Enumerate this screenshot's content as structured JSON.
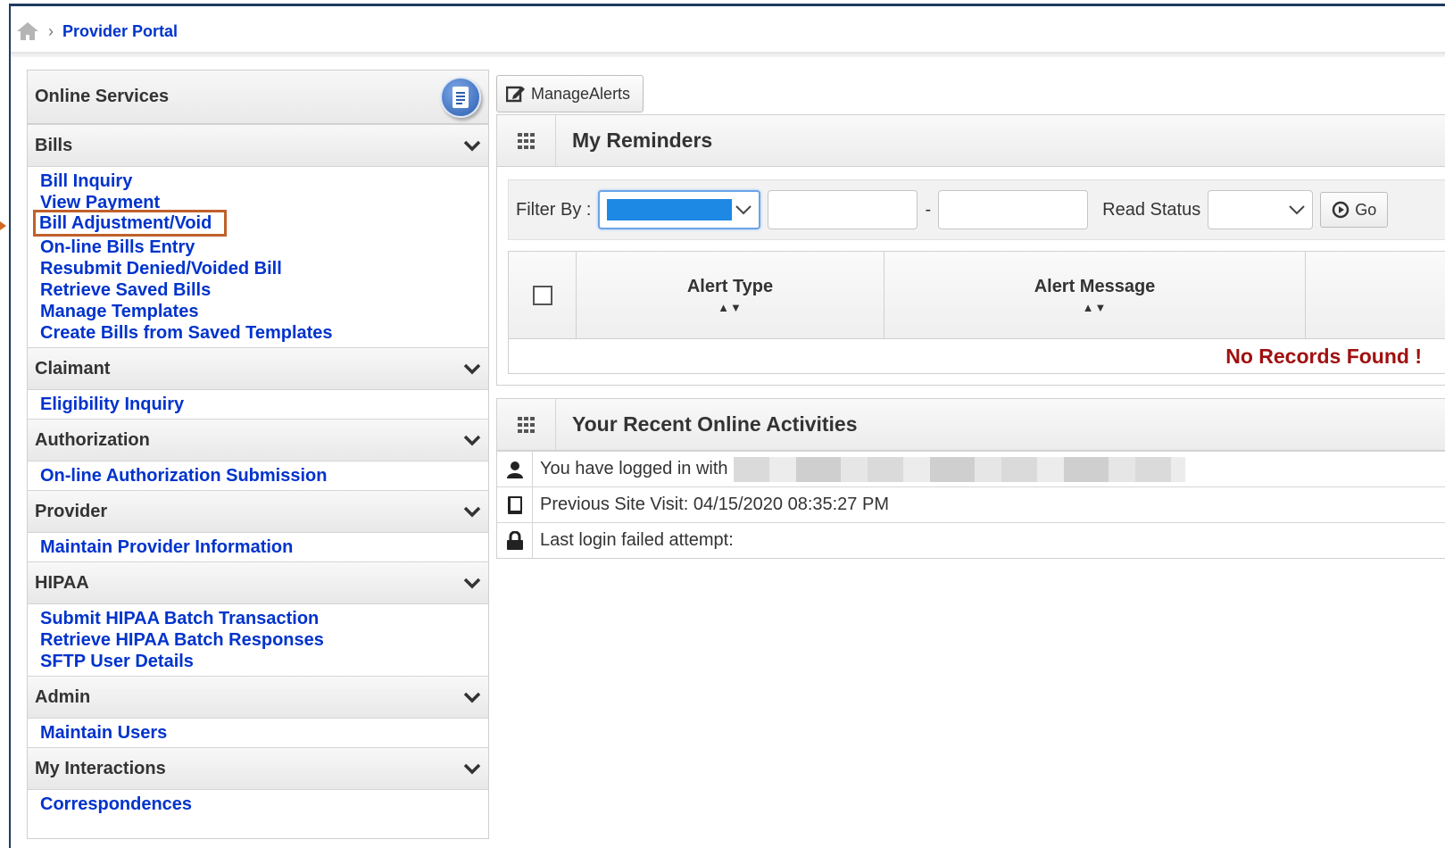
{
  "breadcrumb": {
    "home_icon": "home-icon",
    "separator": "›",
    "current": "Provider Portal"
  },
  "sidebar": {
    "title": "Online Services",
    "icon": "document-icon",
    "sections": [
      {
        "title": "Bills",
        "links": [
          "Bill Inquiry",
          "View Payment",
          "Bill Adjustment/Void",
          "On-line Bills Entry",
          "Resubmit Denied/Voided Bill",
          "Retrieve Saved Bills",
          "Manage Templates",
          "Create Bills from Saved Templates"
        ]
      },
      {
        "title": "Claimant",
        "links": [
          "Eligibility Inquiry"
        ]
      },
      {
        "title": "Authorization",
        "links": [
          "On-line Authorization Submission"
        ]
      },
      {
        "title": "Provider",
        "links": [
          "Maintain Provider Information"
        ]
      },
      {
        "title": "HIPAA",
        "links": [
          "Submit HIPAA Batch Transaction",
          "Retrieve HIPAA Batch Responses",
          "SFTP User Details"
        ]
      },
      {
        "title": "Admin",
        "links": [
          "Maintain Users"
        ]
      },
      {
        "title": "My Interactions",
        "links": [
          "Correspondences"
        ]
      }
    ]
  },
  "manage_alerts": {
    "label": "ManageAlerts",
    "icon": "edit-icon"
  },
  "reminders": {
    "title": "My Reminders",
    "filter_label": "Filter By :",
    "range_separator": "-",
    "read_status_label": "Read Status",
    "go_label": "Go",
    "columns": [
      "Alert Type",
      "Alert Message"
    ],
    "sort_glyph": "▲▼",
    "empty_message": "No Records Found !"
  },
  "activities": {
    "title": "Your Recent Online Activities",
    "rows": [
      {
        "icon": "user-icon",
        "text": "You have logged in with"
      },
      {
        "icon": "book-icon",
        "text": "Previous Site Visit: 04/15/2020 08:35:27 PM"
      },
      {
        "icon": "lock-icon",
        "text": "Last login failed attempt:"
      }
    ]
  },
  "colors": {
    "link": "#0033cc",
    "frame": "#1f3a5f",
    "highlight": "#c0602a",
    "error": "#a01010",
    "select_fill": "#1e88e5"
  }
}
